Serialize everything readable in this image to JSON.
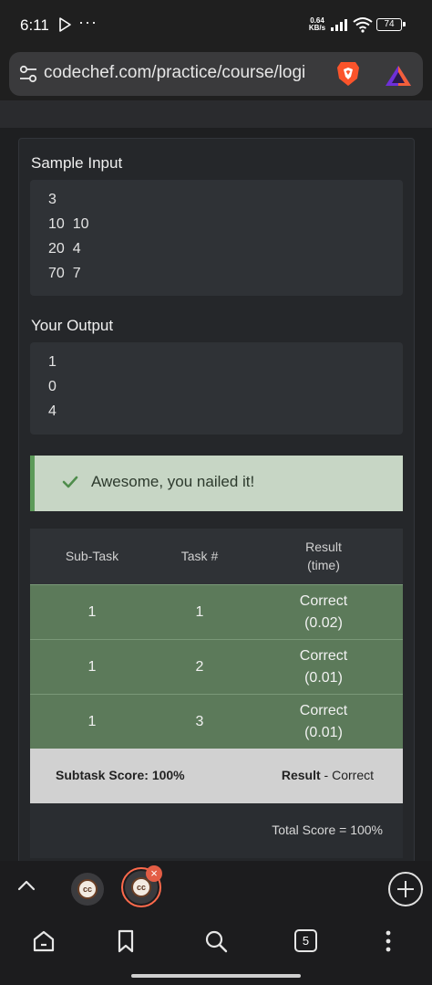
{
  "status_bar": {
    "time": "6:11",
    "more": "···",
    "net_speed_value": "0.64",
    "net_speed_unit": "KB/s",
    "battery": "74"
  },
  "address_bar": {
    "url": "codechef.com/practice/course/logi"
  },
  "sample_input": {
    "title": "Sample Input",
    "lines": [
      "3",
      "10  10",
      "20  4",
      "70  7"
    ]
  },
  "your_output": {
    "title": "Your Output",
    "lines": [
      "1",
      "0",
      "4"
    ]
  },
  "alert": {
    "message": "Awesome, you nailed it!",
    "color": "#c7d6c5",
    "accent": "#5c9a59"
  },
  "results_table": {
    "headers": {
      "subtask": "Sub-Task",
      "task": "Task #",
      "result_line1": "Result",
      "result_line2": "(time)"
    },
    "rows": [
      {
        "subtask": "1",
        "task": "1",
        "result": "Correct",
        "time": "(0.02)"
      },
      {
        "subtask": "1",
        "task": "2",
        "result": "Correct",
        "time": "(0.01)"
      },
      {
        "subtask": "1",
        "task": "3",
        "result": "Correct",
        "time": "(0.01)"
      }
    ],
    "row_color": "#5c7a5a",
    "subtask_score": "Subtask Score: 100%",
    "result_label": "Result",
    "result_value": " - Correct",
    "total_score": "Total Score = 100%"
  },
  "browser_tabs": {
    "favicon_text": "cc",
    "close_symbol": "×"
  },
  "bottom_nav": {
    "tab_count": "5"
  }
}
